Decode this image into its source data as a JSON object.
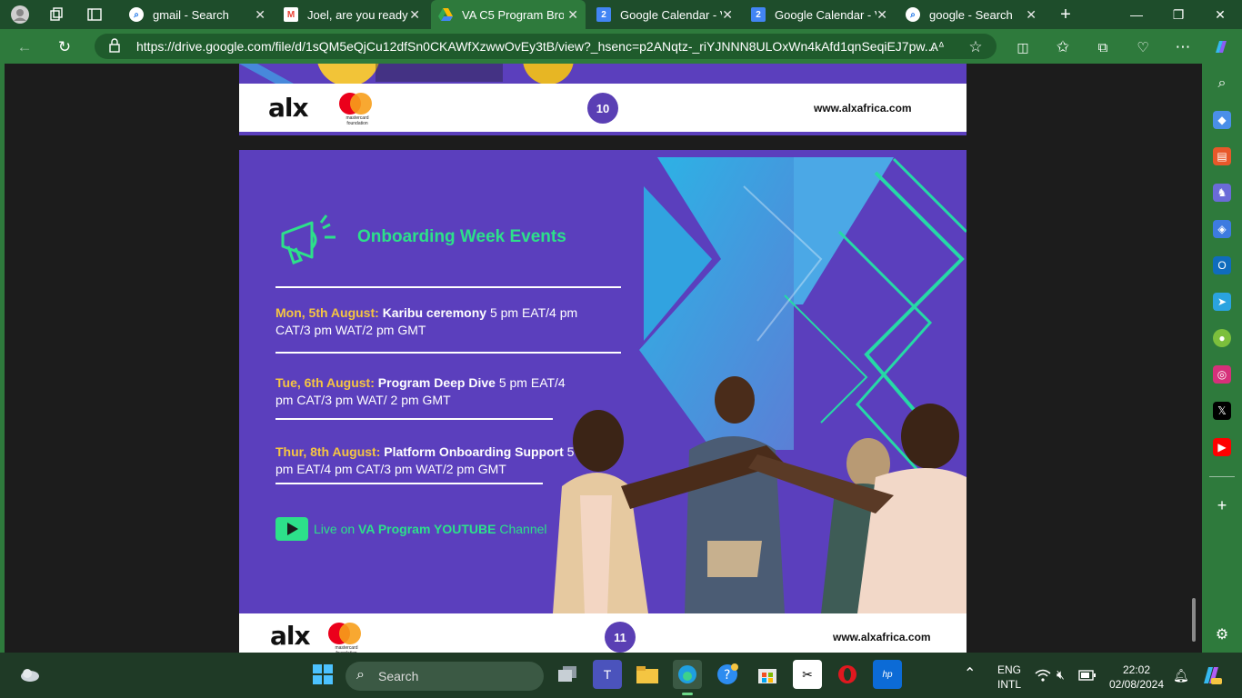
{
  "tabs": [
    {
      "label": "gmail - Search",
      "icon": "search-icon"
    },
    {
      "label": "Joel, are you ready t",
      "icon": "gmail-icon"
    },
    {
      "label": "VA C5 Program Bro",
      "icon": "drive-icon"
    },
    {
      "label": "Google Calendar - V",
      "icon": "calendar-icon"
    },
    {
      "label": "Google Calendar - V",
      "icon": "calendar-icon"
    },
    {
      "label": "google - Search",
      "icon": "search-icon"
    }
  ],
  "address": {
    "url": "https://drive.google.com/file/d/1sQM5eQjCu12dfSn0CKAWfXzwwOvEy3tB/view?_hsenc=p2ANqtz-_riYJNNN8ULOxWn4kAfd1qnSeqiEJ7pw..."
  },
  "slide_prev": {
    "page_number": "10",
    "website": "www.alxafrica.com",
    "logo_text": "alx",
    "mc_text": "mastercard foundation"
  },
  "slide": {
    "title": "Onboarding Week Events",
    "events": [
      {
        "date": "Mon, 5th August:",
        "name": "Karibu ceremony",
        "time": "  5 pm EAT/4 pm CAT/3 pm WAT/2 pm GMT"
      },
      {
        "date": "Tue, 6th August:",
        "name": "Program Deep Dive",
        "time": " 5 pm EAT/4 pm CAT/3 pm WAT/ 2 pm GMT"
      },
      {
        "date": "Thur, 8th August:",
        "name": "Platform Onboarding Support",
        "time": " 5 pm EAT/4 pm CAT/3 pm WAT/2 pm GMT"
      }
    ],
    "live_pre": "Live on ",
    "live_bold": "VA Program YOUTUBE",
    "live_post": " Channel"
  },
  "slide_next": {
    "page_number": "11",
    "website": "www.alxafrica.com",
    "logo_text": "alx",
    "mc_text": "mastercard foundation"
  },
  "taskbar": {
    "search_label": "Search",
    "lang1": "ENG",
    "lang2": "INTL",
    "time": "22:02",
    "date": "02/08/2024"
  },
  "colors": {
    "brand_purple": "#5b3fbd",
    "accent_green": "#2de08a",
    "date_yellow": "#f5c542",
    "browser_green": "#2e7a3c"
  }
}
